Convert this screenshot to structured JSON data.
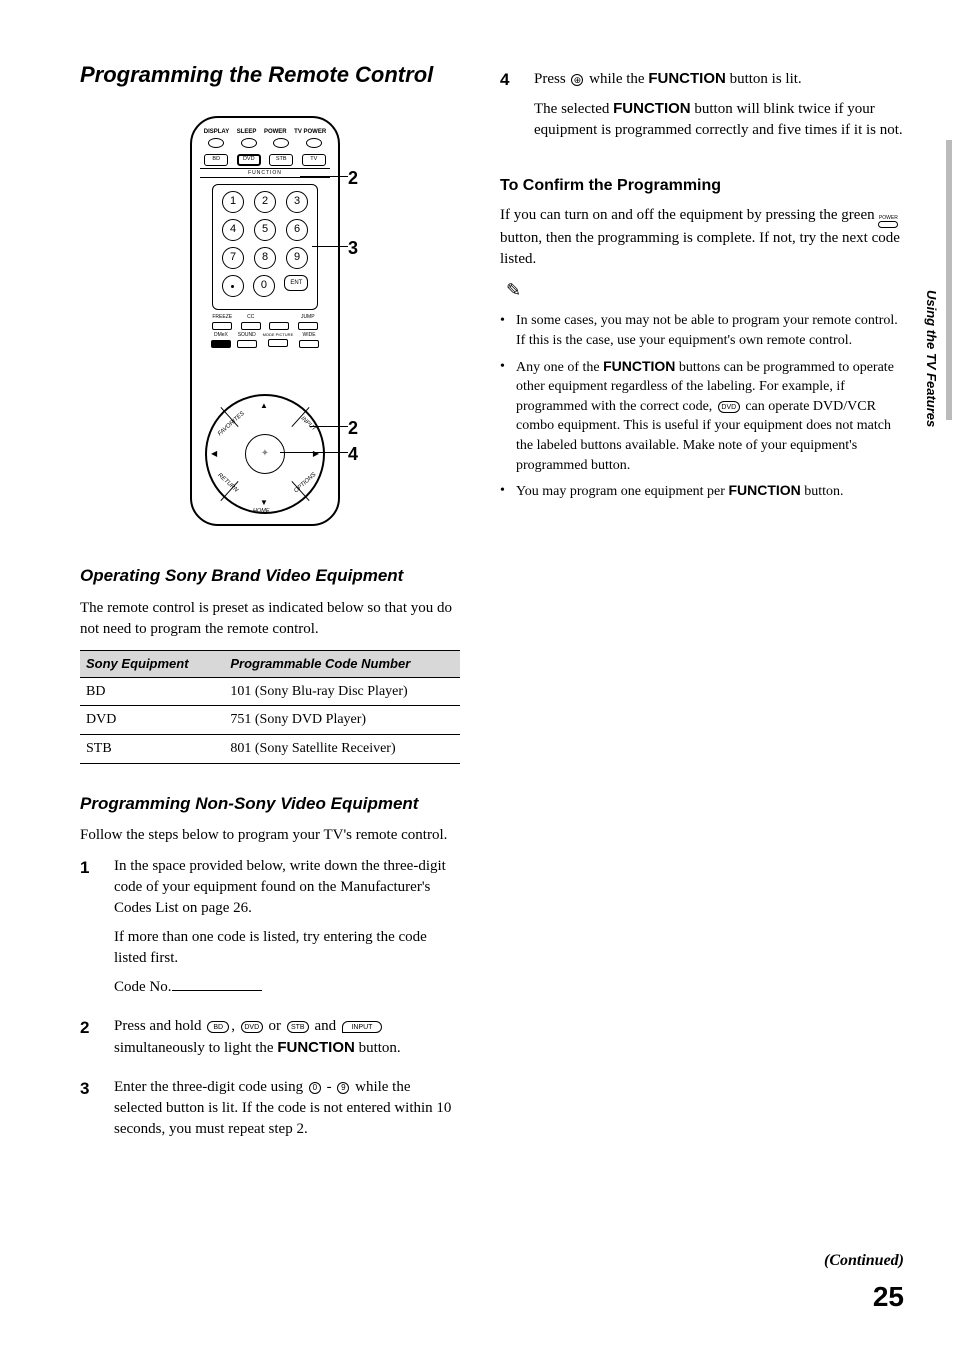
{
  "page": {
    "side_tab": "Using the TV Features",
    "continued": "(Continued)",
    "number": "25"
  },
  "title": "Programming the Remote Control",
  "remote": {
    "top_labels": [
      "DISPLAY",
      "SLEEP",
      "POWER",
      "TV POWER"
    ],
    "func_buttons": [
      "BD",
      "DVD",
      "STB",
      "TV"
    ],
    "func_section_label": "FUNCTION",
    "numpad": [
      "1",
      "2",
      "3",
      "4",
      "5",
      "6",
      "7",
      "8",
      "9",
      ".",
      "0",
      "ENT"
    ],
    "row1_labels": [
      "FREEZE",
      "CC",
      "",
      "JUMP"
    ],
    "row2_labels": [
      "DMeX",
      "SOUND",
      "MODE PICTURE",
      "WIDE"
    ],
    "dpad_labels": {
      "fav": "FAVORITES",
      "input": "INPUT",
      "return": "RETURN",
      "options": "OPTIONS",
      "home": "HOME"
    },
    "callouts": {
      "a": "2",
      "b": "3",
      "c": "2",
      "d": "4"
    }
  },
  "section1": {
    "heading": "Operating Sony Brand Video Equipment",
    "intro": "The remote control is preset as indicated below so that you do not need to program the remote control.",
    "table": {
      "h1": "Sony Equipment",
      "h2": "Programmable Code Number",
      "rows": [
        {
          "eq": "BD",
          "code": "101 (Sony Blu-ray Disc Player)"
        },
        {
          "eq": "DVD",
          "code": "751 (Sony DVD Player)"
        },
        {
          "eq": "STB",
          "code": "801 (Sony Satellite Receiver)"
        }
      ]
    }
  },
  "section2": {
    "heading": "Programming Non-Sony Video Equipment",
    "intro": "Follow the steps below to program your TV's remote control.",
    "steps": [
      {
        "n": "1",
        "p1": "In the space provided below, write down the three-digit code of your equipment found on the Manufacturer's Codes List on page 26.",
        "p2": "If more than one code is listed, try entering the code listed first.",
        "code_label": "Code No."
      },
      {
        "n": "2",
        "pre": "Press and hold ",
        "mid": ", ",
        "mid2": " or ",
        "mid3": " and ",
        "post": " simultaneously to light the ",
        "func": "FUNCTION",
        "end": " button."
      },
      {
        "n": "3",
        "pre": "Enter the three-digit code using ",
        "dash": " - ",
        "post": " while the selected button is lit. If the code is not entered within 10 seconds, you must repeat step 2."
      }
    ]
  },
  "right": {
    "step4": {
      "n": "4",
      "pre": "Press ",
      "post_a": " while the ",
      "func": "FUNCTION",
      "post_b": " button is lit.",
      "p2a": "The selected ",
      "p2b": " button will blink twice if your equipment is programmed correctly and five times if it is not."
    },
    "confirm_heading": "To Confirm the Programming",
    "confirm_body_a": "If you can turn on and off the equipment by pressing the green ",
    "confirm_body_b": " button, then the programming is complete. If not, try the next code listed.",
    "notes": [
      "In some cases, you may not be able to program your remote control. If this is the case, use your equipment's own remote control.",
      {
        "pre": "Any one of the ",
        "func": "FUNCTION",
        "mid": " buttons can be programmed to operate other equipment regardless of the labeling. For example, if programmed with the correct code, ",
        "mid2": " can operate DVD/VCR combo equipment. This is useful if your equipment does not match the labeled buttons available. Make note of your equipment's programmed button."
      },
      {
        "pre": "You may program one equipment per ",
        "func": "FUNCTION",
        "post": " button."
      }
    ],
    "icons": {
      "bd": "BD",
      "dvd": "DVD",
      "stb": "STB",
      "input": "INPUT",
      "power": "POWER"
    }
  }
}
